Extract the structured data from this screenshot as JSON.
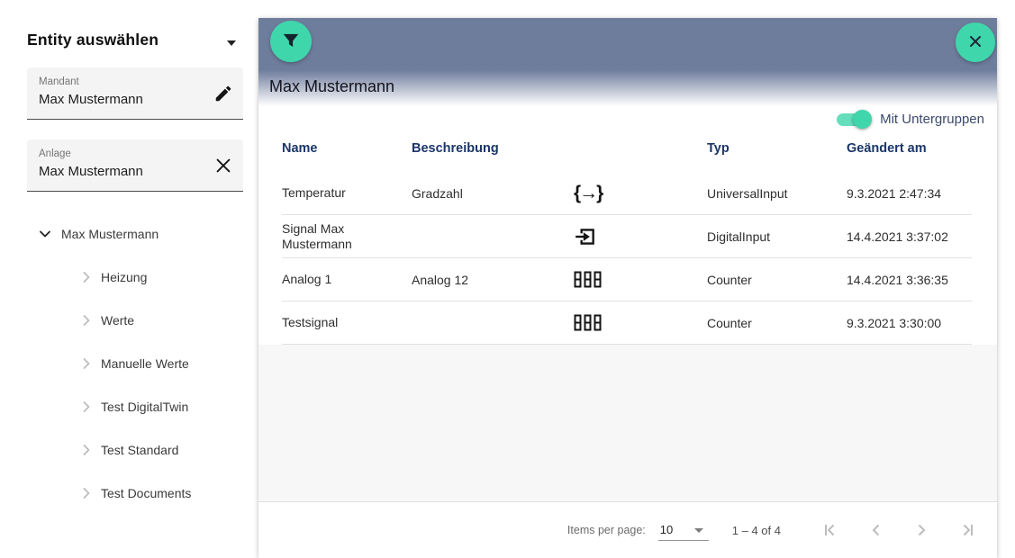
{
  "sidebar": {
    "title": "Entity auswählen",
    "fields": [
      {
        "label": "Mandant",
        "value": "Max Mustermann",
        "icon": "edit-icon"
      },
      {
        "label": "Anlage",
        "value": "Max Mustermann",
        "icon": "clear-icon"
      }
    ],
    "tree": {
      "root": "Max Mustermann",
      "children": [
        "Heizung",
        "Werte",
        "Manuelle Werte",
        "Test DigitalTwin",
        "Test Standard",
        "Test Documents"
      ]
    }
  },
  "panel": {
    "title": "Max Mustermann",
    "toggle": {
      "label": "Mit Untergruppen",
      "state": "on"
    },
    "table": {
      "columns": [
        "Name",
        "Beschreibung",
        "",
        "Typ",
        "Geändert am"
      ],
      "rows": [
        {
          "name": "Temperatur",
          "beschreibung": "Gradzahl",
          "icon": "universal-input-icon",
          "typ": "UniversalInput",
          "geaendert_am": "9.3.2021 2:47:34"
        },
        {
          "name": "Signal Max Mustermann",
          "beschreibung": "",
          "icon": "digital-input-icon",
          "typ": "DigitalInput",
          "geaendert_am": "14.4.2021 3:37:02"
        },
        {
          "name": "Analog 1",
          "beschreibung": "Analog 12",
          "icon": "counter-icon",
          "typ": "Counter",
          "geaendert_am": "14.4.2021 3:36:35"
        },
        {
          "name": "Testsignal",
          "beschreibung": "",
          "icon": "counter-icon",
          "typ": "Counter",
          "geaendert_am": "9.3.2021 3:30:00"
        }
      ]
    },
    "paginator": {
      "items_per_page_label": "Items per page:",
      "page_size": "10",
      "range_label": "1 – 4 of 4"
    }
  },
  "icons": {
    "universal_input_glyph": "{→}"
  },
  "colors": {
    "header_bar": "#6f7d9d",
    "accent_teal": "#3fd6ac",
    "table_header_text": "#1b3668",
    "toggle_label_text": "#3b4a6a"
  }
}
